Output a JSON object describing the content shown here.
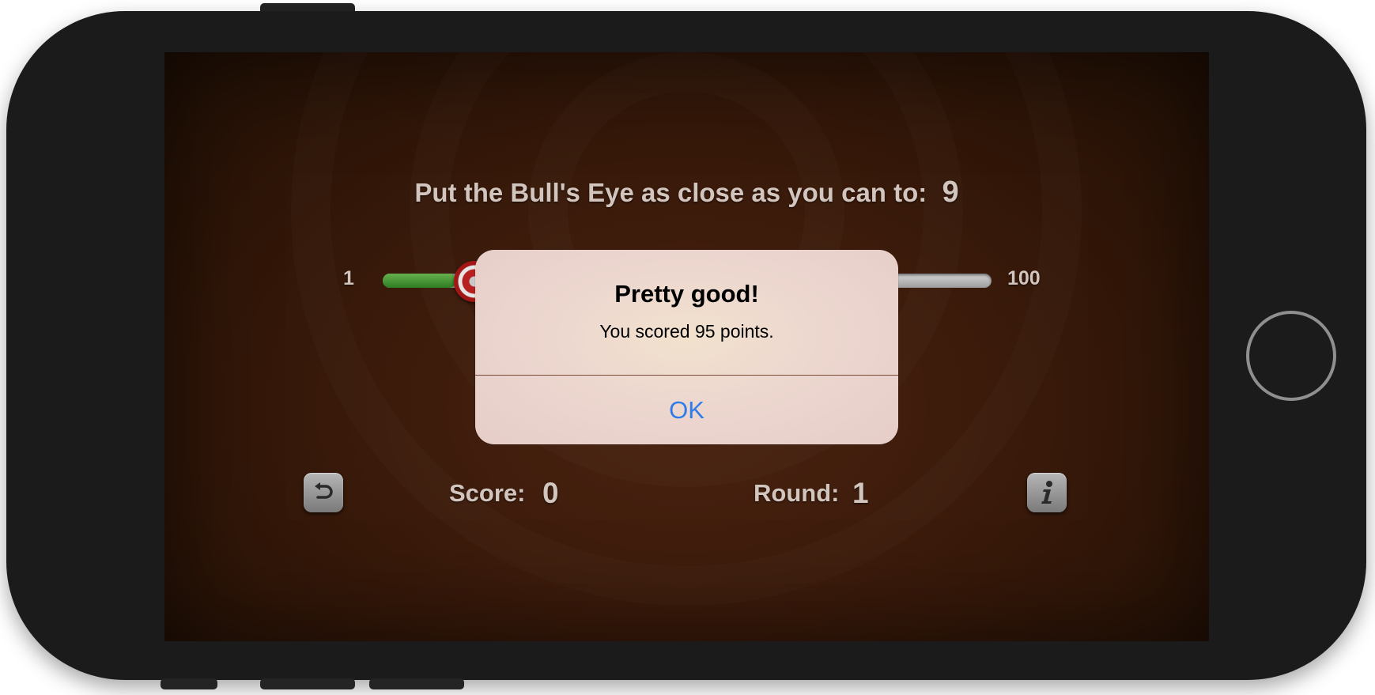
{
  "game": {
    "prompt": "Put the Bull's Eye as close as you can to:",
    "target_value": "9",
    "slider": {
      "min_label": "1",
      "max_label": "100",
      "value": 13,
      "min": 1,
      "max": 100
    },
    "score_label": "Score:",
    "score_value": "0",
    "round_label": "Round:",
    "round_value": "1",
    "start_over_icon": "undo-arrow-icon",
    "info_icon": "info-icon"
  },
  "alert": {
    "title": "Pretty good!",
    "message": "You scored 95 points.",
    "ok_label": "OK",
    "ok_color": "#2f7bea"
  },
  "colors": {
    "background": "#3c1b0b",
    "text": "#d2c5bd",
    "slider_fill": "#4a9a3a",
    "thumb_red": "#b81f1f"
  }
}
